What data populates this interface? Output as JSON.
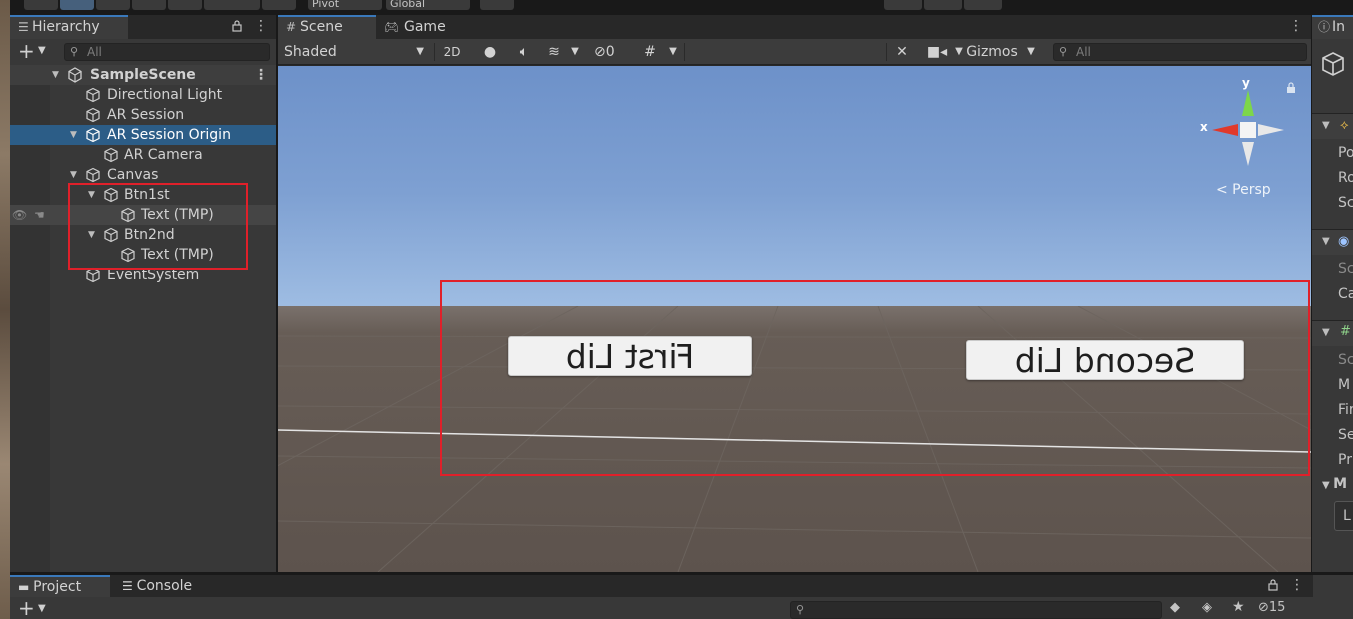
{
  "toolbar": {
    "pivot_label": "Pivot",
    "global_label": "Global"
  },
  "hierarchy": {
    "tab_label": "Hierarchy",
    "search_placeholder": "All",
    "items": [
      {
        "label": "SampleScene",
        "depth": 0
      },
      {
        "label": "Directional Light",
        "depth": 1
      },
      {
        "label": "AR Session",
        "depth": 1
      },
      {
        "label": "AR Session Origin",
        "depth": 1
      },
      {
        "label": "AR Camera",
        "depth": 2
      },
      {
        "label": "Canvas",
        "depth": 1
      },
      {
        "label": "Btn1st",
        "depth": 2
      },
      {
        "label": "Text (TMP)",
        "depth": 3
      },
      {
        "label": "Btn2nd",
        "depth": 2
      },
      {
        "label": "Text (TMP)",
        "depth": 3
      },
      {
        "label": "EventSystem",
        "depth": 1
      }
    ]
  },
  "scene": {
    "tabs": {
      "scene": "Scene",
      "game": "Game"
    },
    "draw_mode": "Shaded",
    "mode_2d": "2D",
    "hidden_count": "0",
    "gizmos_label": "Gizmos",
    "search_placeholder": "All",
    "persp_label": "< Persp",
    "axis_x": "x",
    "axis_y": "y",
    "button_first": "First Lib",
    "button_second": "Second Lib"
  },
  "inspector": {
    "tab_label": "In",
    "rows": [
      "Po",
      "Ro",
      "Sc",
      "Sc",
      "Ca",
      "Sc",
      "M",
      "Fir",
      "Se",
      "Pr",
      "M",
      "L"
    ]
  },
  "bottom": {
    "project_tab": "Project",
    "console_tab": "Console",
    "hidden_count": "15"
  },
  "colors": {
    "selection": "#2c5d87",
    "annotation_red": "#e0202a",
    "tab_accent": "#3a79bb"
  }
}
